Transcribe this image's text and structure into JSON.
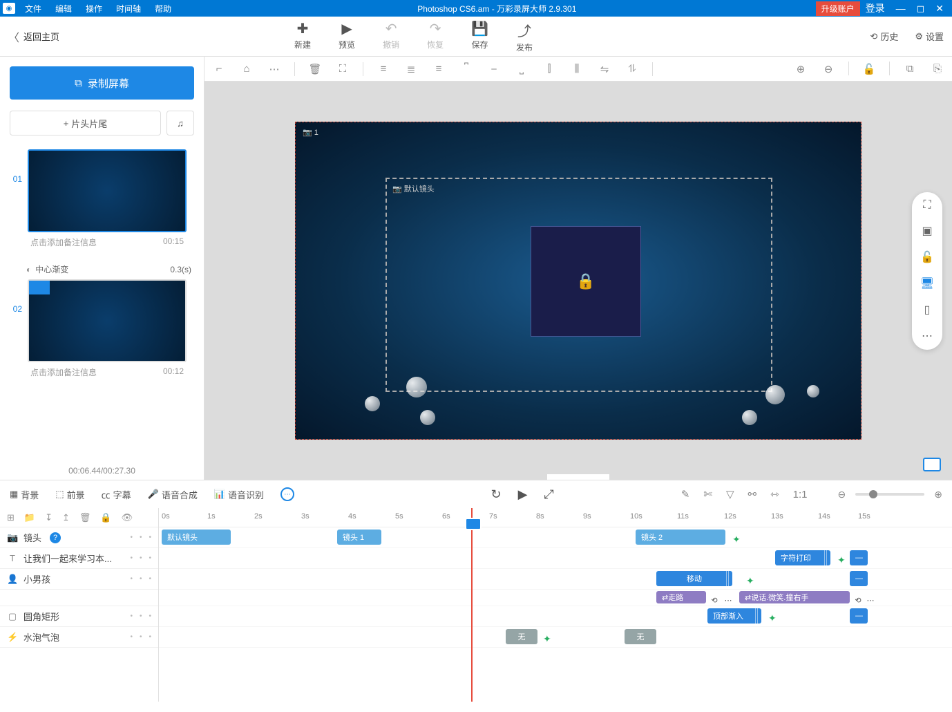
{
  "titlebar": {
    "menus": [
      "文件",
      "编辑",
      "操作",
      "时间轴",
      "帮助"
    ],
    "title": "Photoshop CS6.am - 万彩录屏大师 2.9.301",
    "upgrade": "升级账户",
    "login": "登录"
  },
  "toolbar": {
    "back": "返回主页",
    "buttons": [
      {
        "icon": "＋",
        "label": "新建"
      },
      {
        "icon": "▶",
        "label": "预览"
      },
      {
        "icon": "↶",
        "label": "撤销",
        "disabled": true
      },
      {
        "icon": "↷",
        "label": "恢复",
        "disabled": true
      },
      {
        "icon": "💾",
        "label": "保存"
      },
      {
        "icon": "⤴",
        "label": "发布"
      }
    ],
    "history": "历史",
    "settings": "设置"
  },
  "sidebar": {
    "record": "录制屏幕",
    "titles": "片头片尾",
    "clips": [
      {
        "num": "01",
        "note": "点击添加备注信息",
        "dur": "00:15",
        "trans": "中心渐变",
        "trans_dur": "0.3(s)",
        "border": "active"
      },
      {
        "num": "02",
        "note": "点击添加备注信息",
        "dur": "00:12"
      }
    ],
    "time": "00:06.44/00:27.30"
  },
  "canvas": {
    "outer_label": "1",
    "inner_label": "默认镜头"
  },
  "timeline": {
    "tabs": [
      "背景",
      "前景",
      "字幕",
      "语音合成",
      "语音识别"
    ],
    "ruler": [
      "0s",
      "1s",
      "2s",
      "3s",
      "4s",
      "5s",
      "6s",
      "7s",
      "8s",
      "9s",
      "10s",
      "11s",
      "12s",
      "13s",
      "14s",
      "15s"
    ],
    "rows": [
      {
        "icon": "📷",
        "label": "镜头",
        "help": true
      },
      {
        "icon": "T",
        "label": "让我们一起来学习本..."
      },
      {
        "icon": "👤",
        "label": "小男孩"
      },
      {
        "icon": "▢",
        "label": "圆角矩形"
      },
      {
        "icon": "⚡",
        "label": "水泡气泡"
      }
    ],
    "clips": {
      "lens": [
        "默认镜头",
        "镜头 1",
        "镜头 2"
      ],
      "text": "字符打印",
      "boy_move": "移动",
      "boy_walk": "走路",
      "boy_talk": "说话.微笑.撞右手",
      "rect": "顶部渐入",
      "bubble": [
        "无",
        "无"
      ]
    }
  }
}
